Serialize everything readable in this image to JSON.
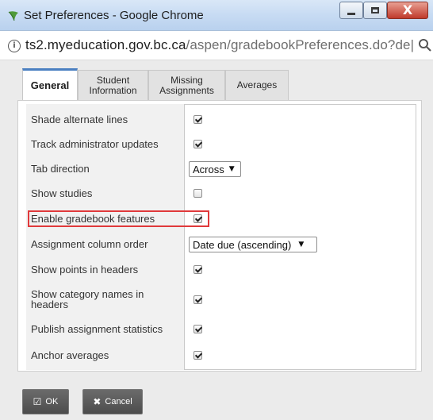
{
  "window": {
    "title": "Set Preferences - Google Chrome",
    "controls": {
      "minimize": "—",
      "maximize": "□",
      "close": "X"
    }
  },
  "address": {
    "host": "ts2.myeducation.gov.bc.ca",
    "path": "/aspen/gradebookPreferences.do?de|",
    "info_icon": "info-icon",
    "zoom_icon": "zoom-icon"
  },
  "tabs": [
    {
      "label": "General",
      "active": true
    },
    {
      "label": "Student Information",
      "active": false
    },
    {
      "label": "Missing Assignments",
      "active": false
    },
    {
      "label": "Averages",
      "active": false
    }
  ],
  "rows": [
    {
      "label": "Shade alternate lines",
      "control": "checkbox",
      "checked": true
    },
    {
      "label": "Track administrator updates",
      "control": "checkbox",
      "checked": true
    },
    {
      "label": "Tab direction",
      "control": "select",
      "value": "Across"
    },
    {
      "label": "Show studies",
      "control": "checkbox",
      "checked": false
    },
    {
      "label": "Enable gradebook features",
      "control": "checkbox",
      "checked": true,
      "highlighted": true
    },
    {
      "label": "Assignment column order",
      "control": "select",
      "value": "Date due (ascending)"
    },
    {
      "label": "Show points in headers",
      "control": "checkbox",
      "checked": true
    },
    {
      "label": "Show category names in headers",
      "control": "checkbox",
      "checked": true
    },
    {
      "label": "Publish assignment statistics",
      "control": "checkbox",
      "checked": true
    },
    {
      "label": "Anchor averages",
      "control": "checkbox",
      "checked": true
    }
  ],
  "buttons": {
    "ok_label": "OK",
    "cancel_label": "Cancel"
  },
  "colors": {
    "highlight": "#e0393b",
    "active_tab_accent": "#4a7fc1",
    "button_bg": "#5a5a5a"
  }
}
